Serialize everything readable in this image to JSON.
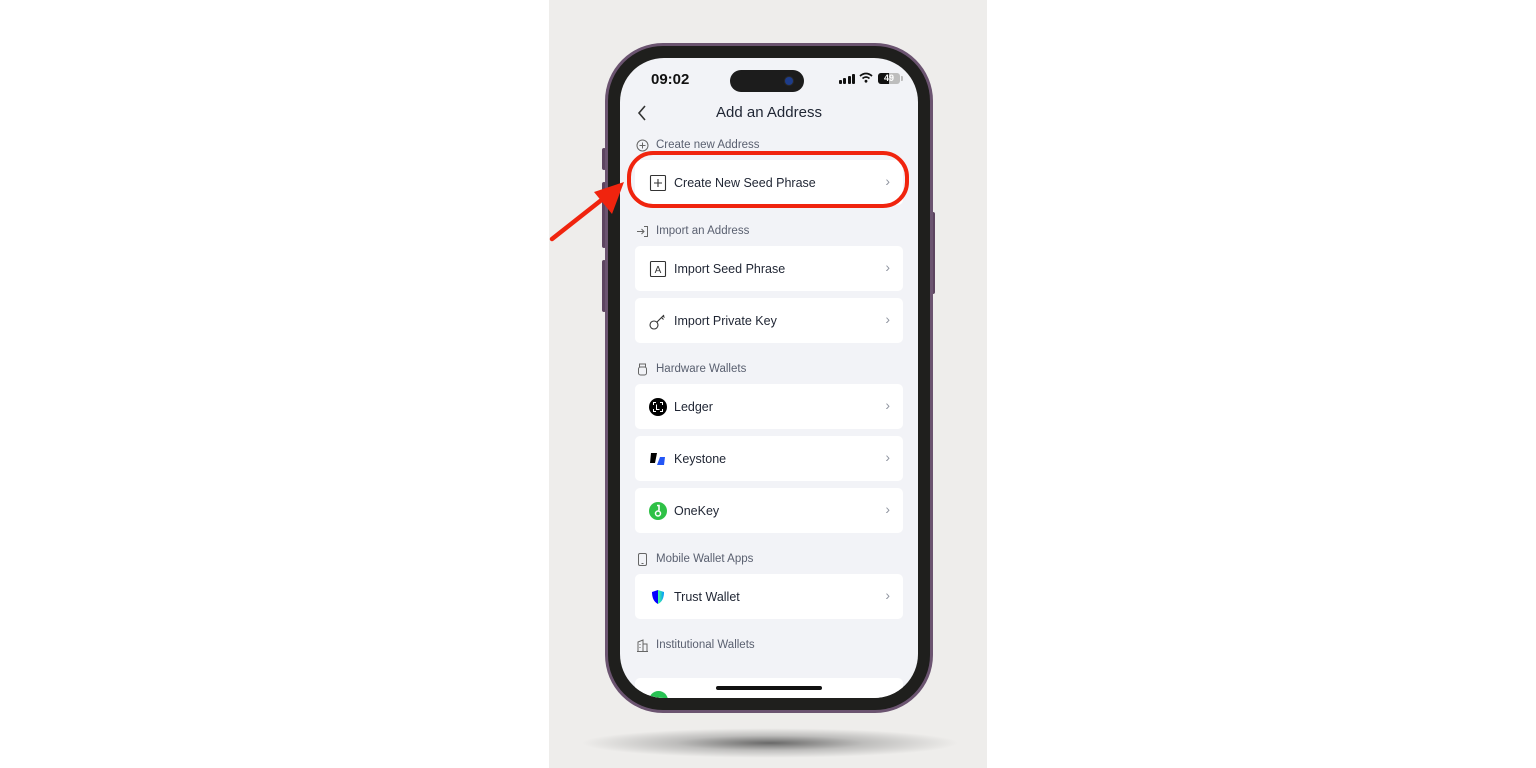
{
  "status_bar": {
    "time": "09:02",
    "battery": "49",
    "battery_fraction": 0.49
  },
  "nav": {
    "back_icon": "chevron-left",
    "title": "Add an Address"
  },
  "sections": [
    {
      "title": "Create new Address",
      "icon": "plus-circle-icon",
      "items": [
        {
          "label": "Create New Seed Phrase",
          "icon": "plus-square-icon",
          "highlighted": true
        }
      ]
    },
    {
      "title": "Import an Address",
      "icon": "import-arrow-icon",
      "items": [
        {
          "label": "Import Seed Phrase",
          "icon": "letter-a-box-icon"
        },
        {
          "label": "Import Private Key",
          "icon": "key-icon"
        }
      ]
    },
    {
      "title": "Hardware Wallets",
      "icon": "usb-device-icon",
      "items": [
        {
          "label": "Ledger",
          "icon": "ledger-logo"
        },
        {
          "label": "Keystone",
          "icon": "keystone-logo"
        },
        {
          "label": "OneKey",
          "icon": "onekey-logo"
        }
      ]
    },
    {
      "title": "Mobile Wallet Apps",
      "icon": "phone-icon",
      "items": [
        {
          "label": "Trust Wallet",
          "icon": "trust-wallet-shield-logo"
        }
      ]
    },
    {
      "title": "Institutional Wallets",
      "icon": "building-icon",
      "items": []
    }
  ],
  "chevron": "›",
  "annotation": {
    "color": "#f0240e",
    "target": "Create New Seed Phrase"
  }
}
